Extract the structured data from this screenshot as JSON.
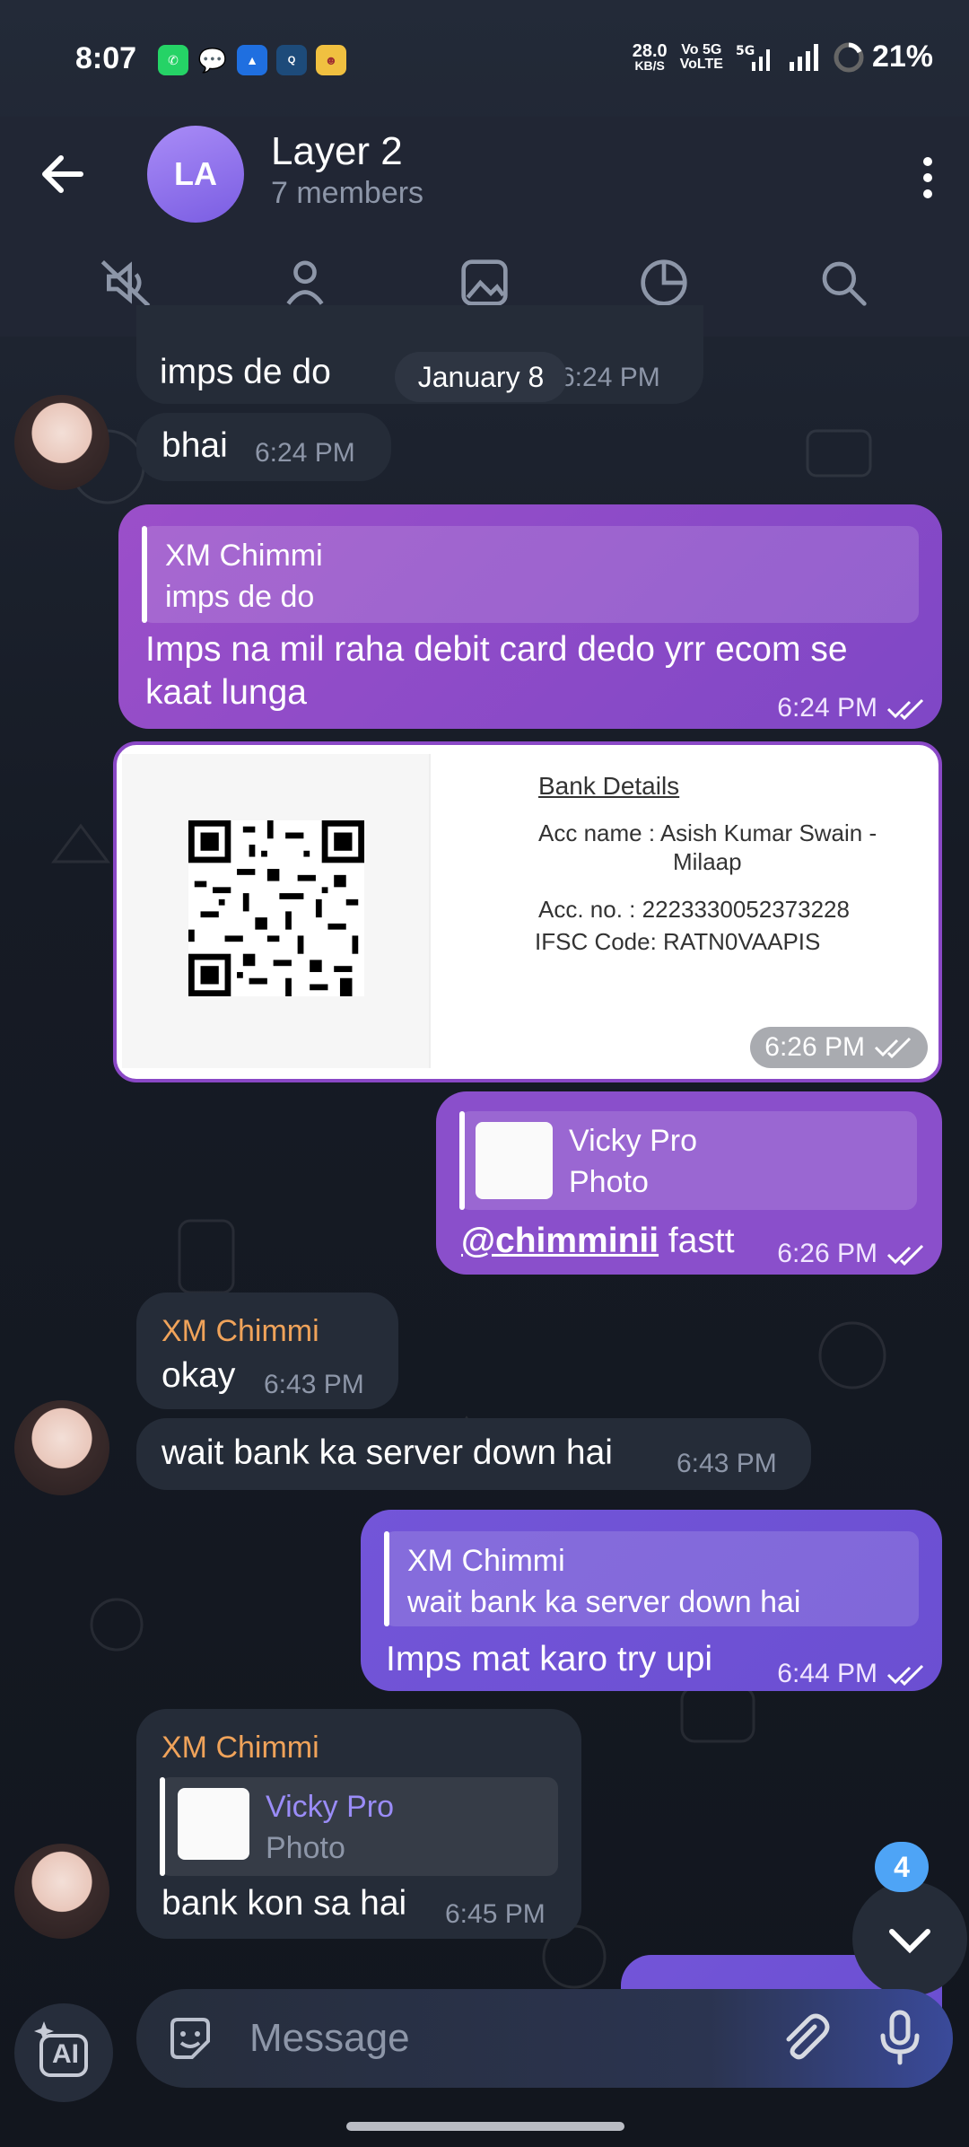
{
  "status_bar": {
    "time": "8:07",
    "net_speed": "28.0",
    "net_unit": "KB/S",
    "volte1": "Vo 5G",
    "volte2": "VoLTE",
    "battery": "21%",
    "apps": [
      "whatsapp-icon",
      "chat-icon",
      "arc-icon",
      "qube-icon",
      "character-icon"
    ]
  },
  "header": {
    "avatar_initials": "LA",
    "title": "Layer 2",
    "subtitle": "7 members",
    "tabs": [
      "mute-icon",
      "members-icon",
      "media-icon",
      "stats-icon",
      "search-icon"
    ]
  },
  "date_chip": "January 8",
  "messages": [
    {
      "id": "m1",
      "text": "imps de do",
      "time": "6:24 PM"
    },
    {
      "id": "m2",
      "text": "bhai",
      "time": "6:24 PM"
    },
    {
      "id": "m3",
      "reply_name": "XM Chimmi",
      "reply_text": "imps de do",
      "text": "Imps na mil raha debit card dedo yrr ecom se kaat lunga",
      "time": "6:24 PM"
    },
    {
      "id": "m4",
      "bank_title": "Bank Details",
      "acc_name": "Acc name : Asish Kumar Swain -",
      "acc_name2": "Milaap",
      "acc_no": "Acc. no. : 2223330052373228",
      "ifsc": "IFSC Code: RATN0VAAPIS",
      "time": "6:26 PM"
    },
    {
      "id": "m5",
      "reply_name": "Vicky Pro",
      "reply_text": "Photo",
      "mention": "@chimminii",
      "text": " fastt",
      "time": "6:26 PM"
    },
    {
      "id": "m6",
      "sender": "XM Chimmi",
      "text": "okay",
      "time": "6:43 PM"
    },
    {
      "id": "m7",
      "text": "wait bank ka server down hai",
      "time": "6:43 PM"
    },
    {
      "id": "m8",
      "reply_name": "XM Chimmi",
      "reply_text": "wait bank ka server down hai",
      "text": "Imps mat karo try upi",
      "time": "6:44 PM"
    },
    {
      "id": "m9",
      "sender": "XM Chimmi",
      "reply_name": "Vicky Pro",
      "reply_text": "Photo",
      "text": "bank kon sa hai",
      "time": "6:45 PM"
    }
  ],
  "scroll_badge": "4",
  "input": {
    "placeholder": "Message",
    "ai_label": "AI"
  },
  "colors": {
    "accent": "#8a5cf0",
    "sender_name": "#f0a35a",
    "mention": "#ffffff",
    "badge": "#4ea4f6"
  }
}
